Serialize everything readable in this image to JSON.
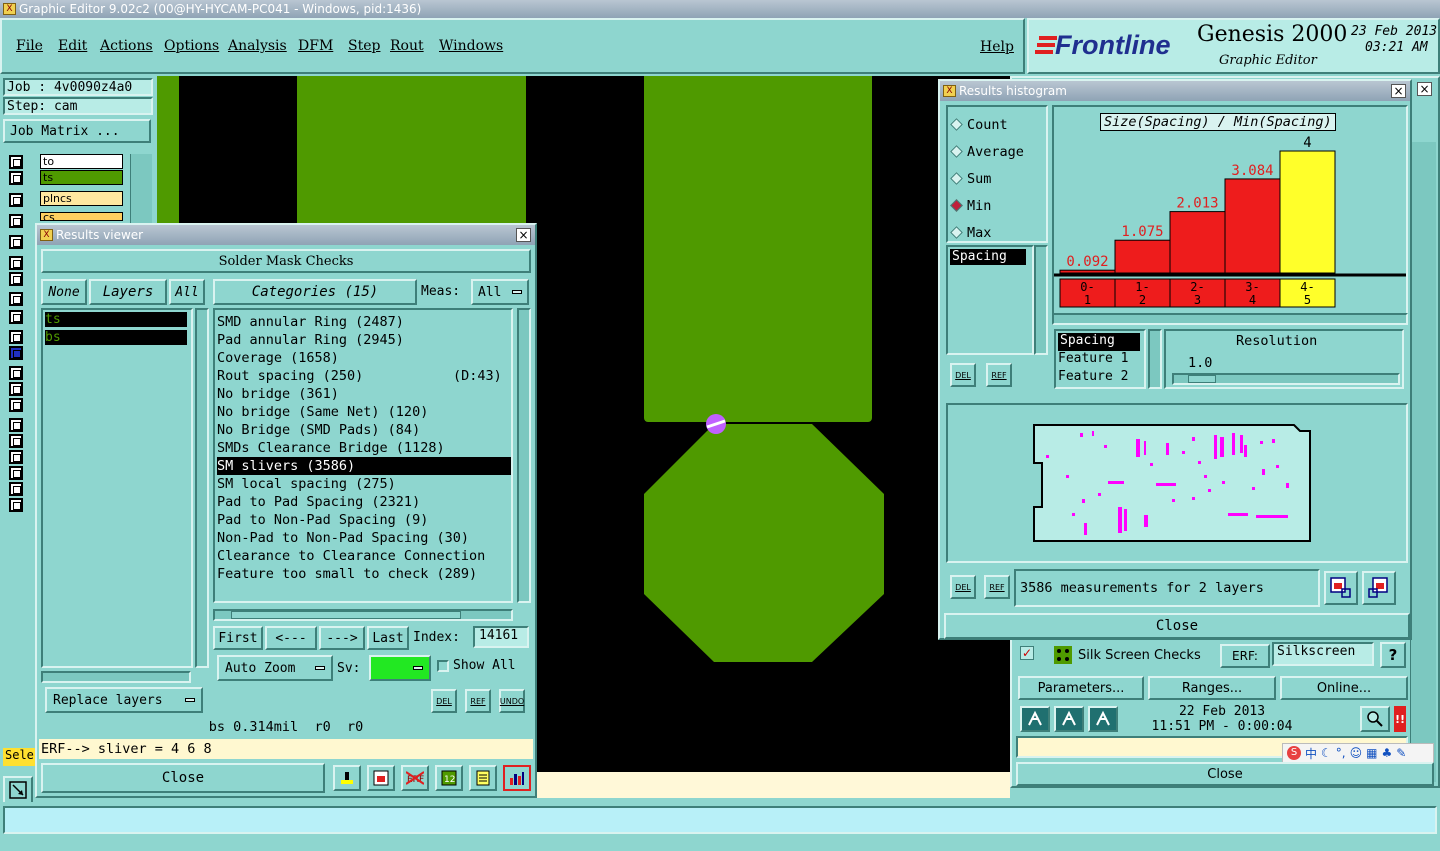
{
  "window": {
    "title": "Graphic Editor 9.02c2 (00@HY-HYCAM-PC041 - Windows, pid:1436)"
  },
  "menu": [
    "File",
    "Edit",
    "Actions",
    "Options",
    "Analysis",
    "DFM",
    "Step",
    "Rout",
    "Windows"
  ],
  "menu_help": "Help",
  "brand": {
    "logo": "Frontline",
    "product": "Genesis 2000",
    "subtitle": "Graphic Editor",
    "date": "23 Feb 2013",
    "time": "03:21 AM"
  },
  "left": {
    "job": "Job : 4v0090z4a0",
    "step": "Step: cam",
    "job_matrix": "Job Matrix ...",
    "layers": [
      "to",
      "ts",
      "plncs",
      "cs"
    ],
    "sele": "Sele"
  },
  "results_viewer": {
    "title": "Results viewer",
    "header": "Solder Mask Checks",
    "none_btn": "None",
    "layers_btn": "Layers",
    "all_btn": "All",
    "categories_btn": "Categories (15)",
    "meas_label": "Meas:",
    "meas_value": "All",
    "layer_list": [
      "ts",
      "bs"
    ],
    "categories": [
      {
        "name": "SMD annular Ring (2487)",
        "extra": ""
      },
      {
        "name": "Pad annular Ring (2945)",
        "extra": ""
      },
      {
        "name": "Coverage (1658)",
        "extra": ""
      },
      {
        "name": "Rout spacing (250)",
        "extra": "(D:43)"
      },
      {
        "name": "No bridge (361)",
        "extra": ""
      },
      {
        "name": "No bridge (Same Net) (120)",
        "extra": ""
      },
      {
        "name": "No Bridge (SMD Pads) (84)",
        "extra": ""
      },
      {
        "name": "SMDs Clearance Bridge (1128)",
        "extra": ""
      },
      {
        "name": "SM slivers (3586)",
        "extra": ""
      },
      {
        "name": "SM local spacing (275)",
        "extra": ""
      },
      {
        "name": "Pad to Pad Spacing (2321)",
        "extra": ""
      },
      {
        "name": "Pad to Non-Pad Spacing (9)",
        "extra": ""
      },
      {
        "name": "Non-Pad to Non-Pad Spacing (30)",
        "extra": ""
      },
      {
        "name": "Clearance to Clearance Connection",
        "extra": ""
      },
      {
        "name": "Feature too small to check (289)",
        "extra": ""
      }
    ],
    "selected_index": 8,
    "nav": {
      "first": "First",
      "prev": "<---",
      "next": "--->",
      "last": "Last",
      "index_label": "Index:",
      "index_value": "14161"
    },
    "auto_zoom": "Auto Zoom",
    "sv_label": "Sv:",
    "show_all": "Show All",
    "replace_layers": "Replace layers",
    "status": "bs 0.314mil  r0  r0",
    "erf_line": "ERF--> sliver = 4 6 8",
    "close": "Close",
    "icons": {
      "del": "DEL",
      "ref": "REF",
      "undo": "UNDO"
    }
  },
  "histogram": {
    "title": "Results histogram",
    "options": [
      "Count",
      "Average",
      "Sum",
      "Min",
      "Max"
    ],
    "selected_option": "Min",
    "list_item": "Spacing",
    "chart_title": "Size(Spacing) / Min(Spacing)",
    "bars": [
      {
        "label": "0.092",
        "value": 0.092,
        "range": "0-\n1",
        "color": "#ee1c1c"
      },
      {
        "label": "1.075",
        "value": 1.075,
        "range": "1-\n2",
        "color": "#ee1c1c"
      },
      {
        "label": "2.013",
        "value": 2.013,
        "range": "2-\n3",
        "color": "#ee1c1c"
      },
      {
        "label": "3.084",
        "value": 3.084,
        "range": "3-\n4",
        "color": "#ee1c1c"
      },
      {
        "label": "4",
        "value": 4,
        "range": "4-\n5",
        "color": "#ffff2a"
      }
    ],
    "ranges": [
      "0-",
      "1",
      "1-",
      "2",
      "2-",
      "3",
      "3-",
      "4",
      "4-",
      "5"
    ],
    "feature_list": [
      "Spacing",
      "Feature 1",
      "Feature 2"
    ],
    "resolution_label": "Resolution",
    "resolution_value": "1.0",
    "measurements": "3586 measurements for 2 layers",
    "close": "Close",
    "del": "DEL",
    "ref": "REF"
  },
  "checks": {
    "silk_label": "Silk Screen Checks",
    "erf_label": "ERF:",
    "erf_value": "Silkscreen",
    "help": "?",
    "parameters": "Parameters...",
    "ranges": "Ranges...",
    "online": "Online...",
    "date": "22 Feb 2013",
    "time": "11:51 PM - 0:00:04",
    "close": "Close",
    "ime": "中"
  },
  "colors": {
    "copper": "#4f9a00",
    "background": "#000000",
    "panel": "#8ed6cf",
    "bar_red": "#ee1c1c",
    "bar_yellow": "#ffff2a",
    "marker": "#c060ff"
  }
}
